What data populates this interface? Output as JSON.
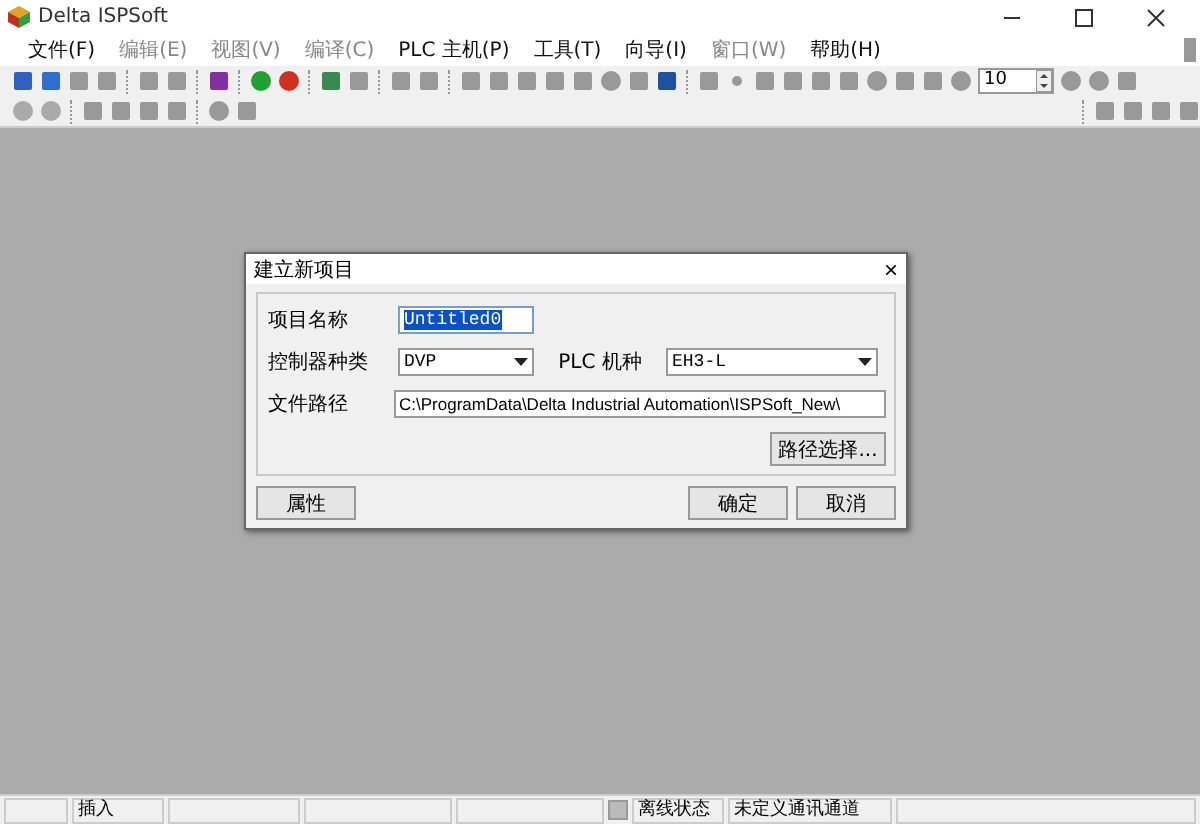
{
  "window": {
    "title": "Delta ISPSoft"
  },
  "menu": [
    {
      "label": "文件(F)",
      "disabled": false
    },
    {
      "label": "编辑(E)",
      "disabled": true
    },
    {
      "label": "视图(V)",
      "disabled": true
    },
    {
      "label": "编译(C)",
      "disabled": true
    },
    {
      "label": "PLC 主机(P)",
      "disabled": false
    },
    {
      "label": "工具(T)",
      "disabled": false
    },
    {
      "label": "向导(I)",
      "disabled": false
    },
    {
      "label": "窗口(W)",
      "disabled": true
    },
    {
      "label": "帮助(H)",
      "disabled": false
    }
  ],
  "toolbar": {
    "step_field": {
      "value": "10"
    }
  },
  "dialog": {
    "title": "建立新项目",
    "close": "×",
    "name_label": "项目名称",
    "name_value": "Untitled0",
    "controller_label": "控制器种类",
    "controller_value": "DVP",
    "model_label": "PLC 机种",
    "model_value": "EH3-L",
    "path_label": "文件路径",
    "path_value": "C:\\ProgramData\\Delta Industrial Automation\\ISPSoft_New\\",
    "browse_button": "路径选择...",
    "properties_button": "属性",
    "ok_button": "确定",
    "cancel_button": "取消"
  },
  "status_bar": {
    "mode": "插入",
    "connection_state": "离线状态",
    "channel": "未定义通讯通道"
  }
}
